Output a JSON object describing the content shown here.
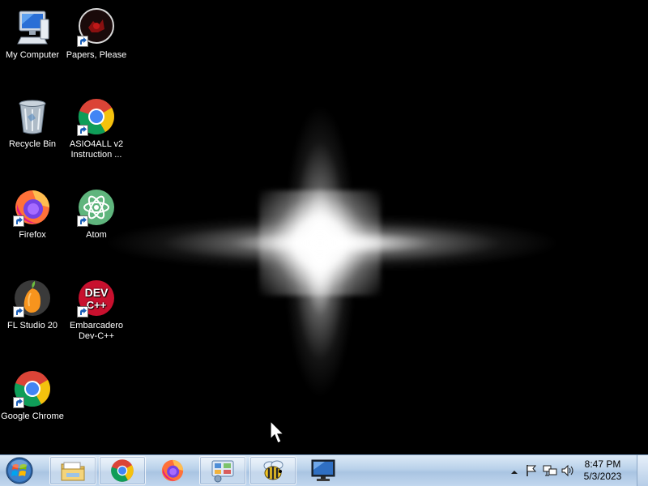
{
  "desktop": {
    "icons": [
      {
        "label": "My Computer",
        "icon": "my-computer-icon"
      },
      {
        "label": "Papers, Please",
        "icon": "papers-please-icon"
      },
      {
        "label": "Recycle Bin",
        "icon": "recycle-bin-icon"
      },
      {
        "label": "ASIO4ALL v2 Instruction ...",
        "icon": "asio4all-icon"
      },
      {
        "label": "Firefox",
        "icon": "firefox-icon"
      },
      {
        "label": "Atom",
        "icon": "atom-icon"
      },
      {
        "label": "FL Studio 20",
        "icon": "fl-studio-icon"
      },
      {
        "label": "Embarcadero Dev-C++",
        "icon": "devcpp-icon"
      },
      {
        "label": "Google Chrome",
        "icon": "chrome-icon"
      }
    ],
    "devcpp_logo_text": "DEV C++"
  },
  "taskbar": {
    "buttons": [
      {
        "name": "start-button",
        "icon": "windows-orb-icon"
      },
      {
        "name": "windows-explorer",
        "icon": "folder-icon"
      },
      {
        "name": "google-chrome",
        "icon": "chrome-icon"
      },
      {
        "name": "firefox",
        "icon": "firefox-icon"
      },
      {
        "name": "control-panel",
        "icon": "control-panel-icon"
      },
      {
        "name": "bee-app",
        "icon": "bee-icon"
      },
      {
        "name": "display-monitor",
        "icon": "monitor-icon"
      }
    ],
    "tray": {
      "icons": [
        "chevron-up-icon",
        "action-center-flag-icon",
        "network-icon",
        "volume-icon"
      ],
      "time": "8:47 PM",
      "date": "5/3/2023"
    }
  },
  "colors": {
    "taskbar_top": "#dce9f6",
    "taskbar_bottom": "#a9c4e2",
    "desktop_bg": "#000000"
  }
}
